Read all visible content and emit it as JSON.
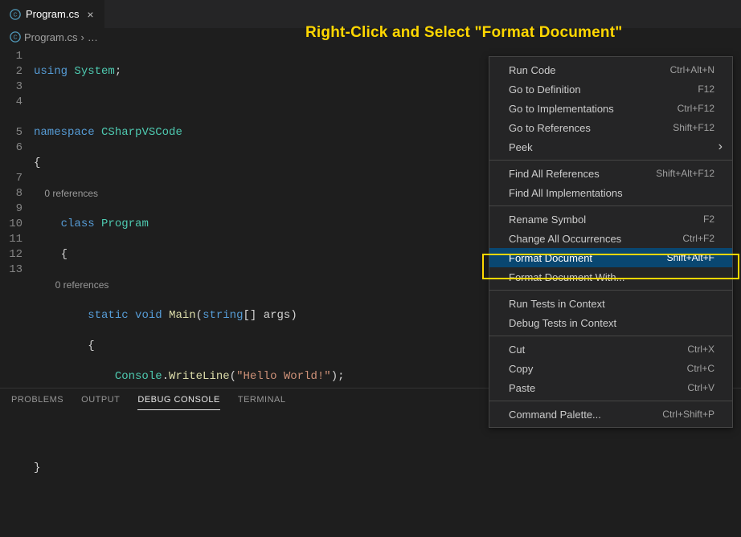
{
  "tab": {
    "filename": "Program.cs"
  },
  "breadcrumb": {
    "file": "Program.cs",
    "sep": "›",
    "more": "…"
  },
  "annotation": "Right-Click and Select \"Format Document\"",
  "code": {
    "lines": {
      "l1": {
        "n": "1",
        "using": "using",
        "system": "System",
        "semi": ";"
      },
      "l2": {
        "n": "2"
      },
      "l3": {
        "n": "3",
        "namespace": "namespace",
        "name": "CSharpVSCode"
      },
      "l4": {
        "n": "4",
        "brace": "{"
      },
      "cl1": "0 references",
      "l5": {
        "n": "5",
        "class": "class",
        "name": "Program"
      },
      "l6": {
        "n": "6",
        "brace": "{"
      },
      "cl2": "0 references",
      "l7": {
        "n": "7",
        "static": "static",
        "void": "void",
        "main": "Main",
        "paren1": "(",
        "string": "string",
        "brackets": "[]",
        "args": " args",
        "paren2": ")"
      },
      "l8": {
        "n": "8",
        "brace": "{"
      },
      "l9": {
        "n": "9",
        "console": "Console",
        "dot": ".",
        "writeline": "WriteLine",
        "paren1": "(",
        "str": "\"Hello World!\"",
        "paren2": ");"
      },
      "l10": {
        "n": "10",
        "brace": "}"
      },
      "l11": {
        "n": "11",
        "brace": "}"
      },
      "l12": {
        "n": "12",
        "brace": "}"
      },
      "l13": {
        "n": "13"
      }
    }
  },
  "panel": {
    "tabs": [
      "PROBLEMS",
      "OUTPUT",
      "DEBUG CONSOLE",
      "TERMINAL"
    ],
    "active": 2
  },
  "menu": [
    {
      "label": "Run Code",
      "shortcut": "Ctrl+Alt+N"
    },
    {
      "label": "Go to Definition",
      "shortcut": "F12"
    },
    {
      "label": "Go to Implementations",
      "shortcut": "Ctrl+F12"
    },
    {
      "label": "Go to References",
      "shortcut": "Shift+F12"
    },
    {
      "label": "Peek",
      "arrow": true
    },
    {
      "sep": true
    },
    {
      "label": "Find All References",
      "shortcut": "Shift+Alt+F12"
    },
    {
      "label": "Find All Implementations"
    },
    {
      "sep": true
    },
    {
      "label": "Rename Symbol",
      "shortcut": "F2"
    },
    {
      "label": "Change All Occurrences",
      "shortcut": "Ctrl+F2"
    },
    {
      "label": "Format Document",
      "shortcut": "Shift+Alt+F",
      "selected": true
    },
    {
      "label": "Format Document With..."
    },
    {
      "sep": true
    },
    {
      "label": "Run Tests in Context"
    },
    {
      "label": "Debug Tests in Context"
    },
    {
      "sep": true
    },
    {
      "label": "Cut",
      "shortcut": "Ctrl+X"
    },
    {
      "label": "Copy",
      "shortcut": "Ctrl+C"
    },
    {
      "label": "Paste",
      "shortcut": "Ctrl+V"
    },
    {
      "sep": true
    },
    {
      "label": "Command Palette...",
      "shortcut": "Ctrl+Shift+P"
    }
  ]
}
